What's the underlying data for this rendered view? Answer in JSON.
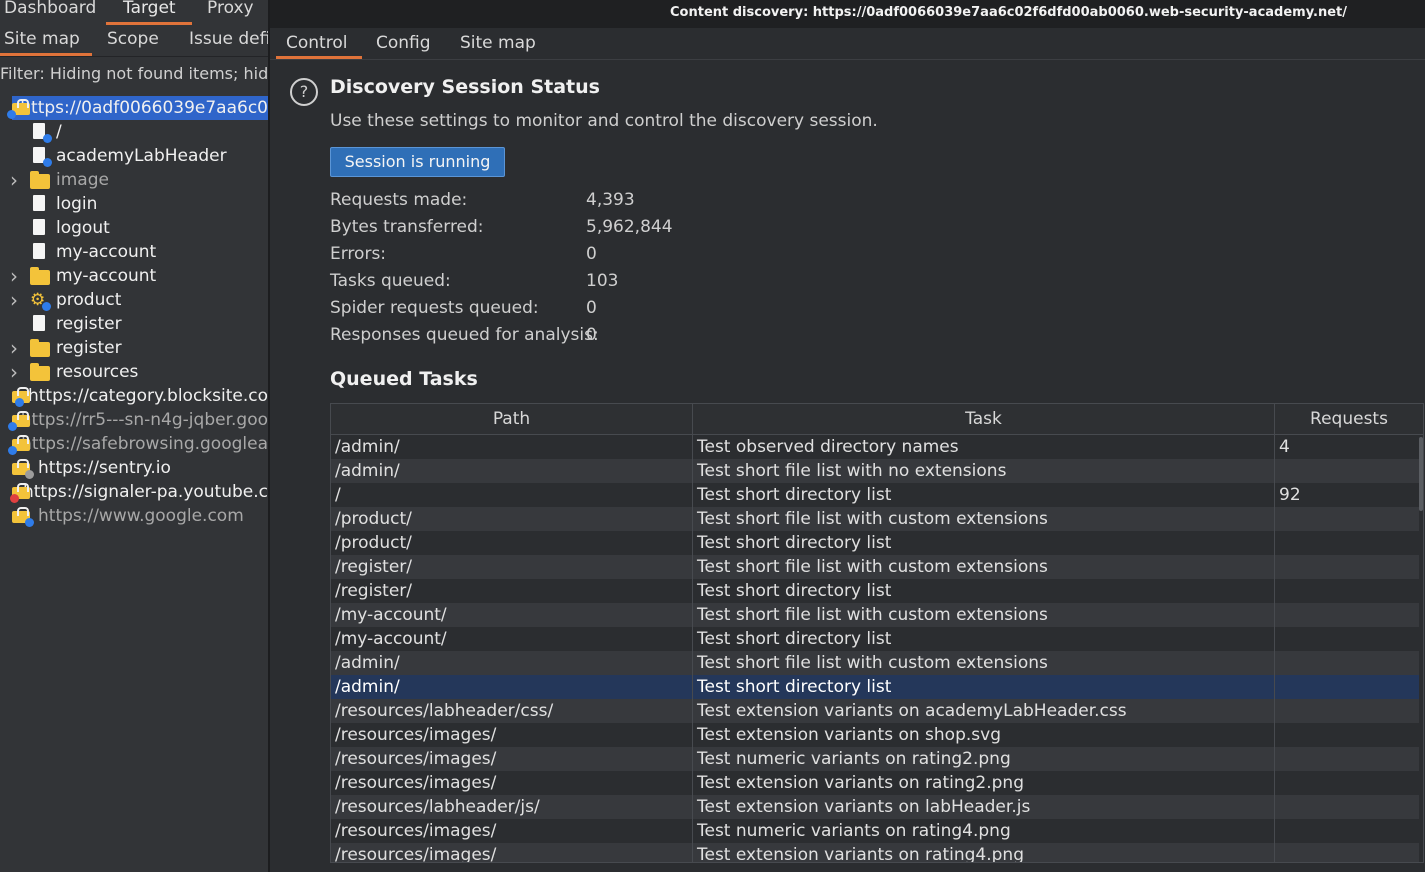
{
  "left": {
    "top_tabs": [
      "Dashboard",
      "Target",
      "Proxy"
    ],
    "active_top_tab": "Target",
    "sub_tabs": [
      "Site map",
      "Scope",
      "Issue defi"
    ],
    "filter_text": "Filter: Hiding not found items;  hidir",
    "tree": [
      {
        "label": "https://0adf0066039e7aa6c0",
        "icon": "host-icon",
        "badge": "blue",
        "selected": true,
        "dim": false
      },
      {
        "label": "/",
        "icon": "file-icon",
        "badge": "blue",
        "dim": false
      },
      {
        "label": "academyLabHeader",
        "icon": "file-icon",
        "badge": "blue",
        "dim": false
      },
      {
        "label": "image",
        "icon": "folder-icon",
        "dim": true,
        "expandable": true
      },
      {
        "label": "login",
        "icon": "file-icon",
        "dim": false
      },
      {
        "label": "logout",
        "icon": "file-icon",
        "dim": false
      },
      {
        "label": "my-account",
        "icon": "file-icon",
        "dim": false
      },
      {
        "label": "my-account",
        "icon": "folder-icon",
        "dim": false,
        "expandable": true
      },
      {
        "label": "product",
        "icon": "gear-icon",
        "badge": "blue",
        "dim": false,
        "expandable": true
      },
      {
        "label": "register",
        "icon": "file-icon",
        "dim": false
      },
      {
        "label": "register",
        "icon": "folder-icon",
        "dim": false,
        "expandable": true
      },
      {
        "label": "resources",
        "icon": "folder-icon",
        "dim": false,
        "expandable": true
      },
      {
        "label": "https://category.blocksite.co",
        "icon": "host-icon",
        "badge": "blue",
        "dim": false
      },
      {
        "label": "https://rr5---sn-n4g-jqber.goo",
        "icon": "host-icon",
        "badge": "blue",
        "dim": true
      },
      {
        "label": "https://safebrowsing.googlea",
        "icon": "host-icon",
        "badge": "blue",
        "dim": true
      },
      {
        "label": "https://sentry.io",
        "icon": "host-icon",
        "badge": "grey",
        "dim": false
      },
      {
        "label": "https://signaler-pa.youtube.c",
        "icon": "host-icon",
        "badge": "red",
        "dim": false
      },
      {
        "label": "https://www.google.com",
        "icon": "host-icon",
        "badge": "blue",
        "dim": true
      }
    ]
  },
  "dialog": {
    "title": "Content discovery: https://0adf0066039e7aa6c02f6dfd00ab0060.web-security-academy.net/",
    "tabs": [
      "Control",
      "Config",
      "Site map"
    ],
    "active_tab": "Control",
    "heading": "Discovery Session Status",
    "description": "Use these settings to monitor and control the discovery session.",
    "session_button": "Session is running",
    "stats": [
      {
        "label": "Requests made:",
        "value": "4,393"
      },
      {
        "label": "Bytes transferred:",
        "value": "5,962,844"
      },
      {
        "label": "Errors:",
        "value": "0"
      },
      {
        "label": "Tasks queued:",
        "value": "103"
      },
      {
        "label": "Spider requests queued:",
        "value": "0"
      },
      {
        "label": "Responses queued for analysis:",
        "value": "0"
      }
    ],
    "queued_heading": "Queued Tasks",
    "columns": [
      "Path",
      "Task",
      "Requests"
    ],
    "rows": [
      {
        "path": "/admin/",
        "task": "Test observed directory names",
        "requests": "4"
      },
      {
        "path": "/admin/",
        "task": "Test short file list with no extensions",
        "requests": ""
      },
      {
        "path": "/",
        "task": "Test short directory list",
        "requests": "92"
      },
      {
        "path": "/product/",
        "task": "Test short file list with custom extensions",
        "requests": ""
      },
      {
        "path": "/product/",
        "task": "Test short directory list",
        "requests": ""
      },
      {
        "path": "/register/",
        "task": "Test short file list with custom extensions",
        "requests": ""
      },
      {
        "path": "/register/",
        "task": "Test short directory list",
        "requests": ""
      },
      {
        "path": "/my-account/",
        "task": "Test short file list with custom extensions",
        "requests": ""
      },
      {
        "path": "/my-account/",
        "task": "Test short directory list",
        "requests": ""
      },
      {
        "path": "/admin/",
        "task": "Test short file list with custom extensions",
        "requests": ""
      },
      {
        "path": "/admin/",
        "task": "Test short directory list",
        "requests": "",
        "selected": true
      },
      {
        "path": "/resources/labheader/css/",
        "task": "Test extension variants on academyLabHeader.css",
        "requests": ""
      },
      {
        "path": "/resources/images/",
        "task": "Test extension variants on shop.svg",
        "requests": ""
      },
      {
        "path": "/resources/images/",
        "task": "Test numeric variants on rating2.png",
        "requests": ""
      },
      {
        "path": "/resources/images/",
        "task": "Test extension variants on rating2.png",
        "requests": ""
      },
      {
        "path": "/resources/labheader/js/",
        "task": "Test extension variants on labHeader.js",
        "requests": ""
      },
      {
        "path": "/resources/images/",
        "task": "Test numeric variants on rating4.png",
        "requests": ""
      },
      {
        "path": "/resources/images/",
        "task": "Test extension variants on rating4.png",
        "requests": ""
      }
    ]
  }
}
